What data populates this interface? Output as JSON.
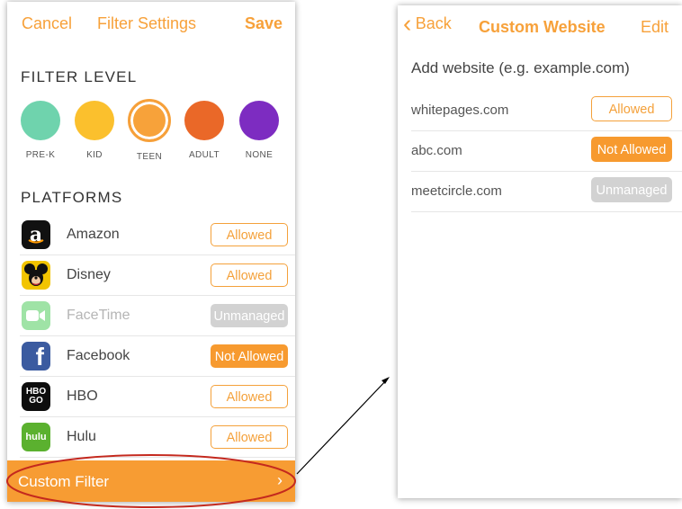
{
  "left_screen": {
    "nav": {
      "cancel": "Cancel",
      "title": "Filter Settings",
      "save": "Save"
    },
    "filter_level_title": "FILTER LEVEL",
    "levels": [
      {
        "label": "PRE-K",
        "color": "#6fd3ad"
      },
      {
        "label": "KID",
        "color": "#fbc02d"
      },
      {
        "label": "TEEN",
        "color": "#f7a23a",
        "selected": true
      },
      {
        "label": "ADULT",
        "color": "#ea6828"
      },
      {
        "label": "NONE",
        "color": "#7d2cc1"
      }
    ],
    "platforms_title": "PLATFORMS",
    "platforms": [
      {
        "name": "Amazon",
        "status": "Allowed",
        "icon": "amazon-icon"
      },
      {
        "name": "Disney",
        "status": "Allowed",
        "icon": "disney-icon"
      },
      {
        "name": "FaceTime",
        "status": "Unmanaged",
        "icon": "facetime-icon"
      },
      {
        "name": "Facebook",
        "status": "Not Allowed",
        "icon": "facebook-icon"
      },
      {
        "name": "HBO",
        "status": "Allowed",
        "icon": "hbo-go-icon"
      },
      {
        "name": "Hulu",
        "status": "Allowed",
        "icon": "hulu-icon"
      }
    ],
    "icon_text": {
      "amazon": "a",
      "facebook": "f",
      "hbo_top": "HBO",
      "hbo_bottom": "GO",
      "hulu": "hulu"
    },
    "custom_filter": {
      "label": "Custom Filter",
      "chevron": "›"
    }
  },
  "right_screen": {
    "nav": {
      "back": "Back",
      "back_chevron": "‹",
      "title": "Custom Website",
      "edit": "Edit"
    },
    "add_website_label": "Add website (e.g. example.com)",
    "websites": [
      {
        "domain": "whitepages.com",
        "status": "Allowed"
      },
      {
        "domain": "abc.com",
        "status": "Not Allowed"
      },
      {
        "domain": "meetcircle.com",
        "status": "Unmanaged"
      }
    ]
  },
  "colors": {
    "accent": "#f7a13a",
    "highlight_ellipse": "#c4291e",
    "arrow": "#000000"
  }
}
